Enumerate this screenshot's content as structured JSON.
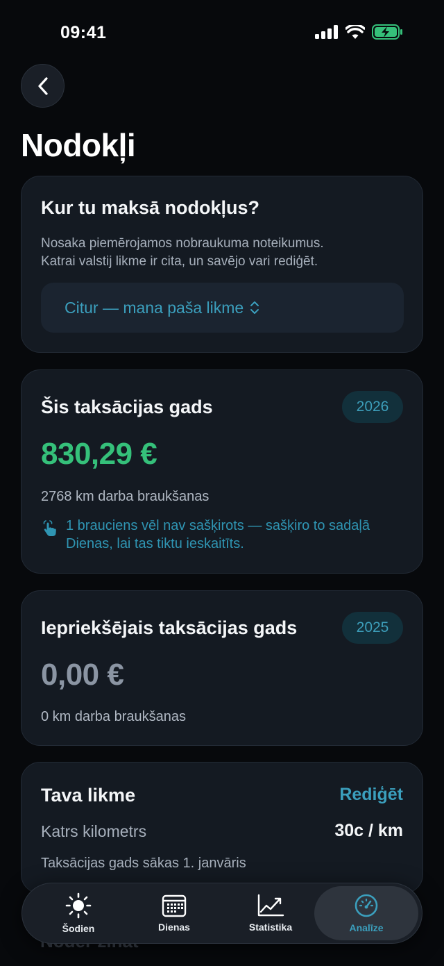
{
  "status_bar": {
    "time": "09:41"
  },
  "page": {
    "title": "Nodokļi"
  },
  "location_card": {
    "title": "Kur tu maksā nodokļus?",
    "description_lines": [
      "Nosaka piemērojamos nobraukuma noteikumus.",
      "Katrai valstij likme ir cita, un savējo vari rediģēt."
    ],
    "selected_option": "Citur — mana paša likme"
  },
  "current_year_card": {
    "title": "Šis taksācijas gads",
    "year": "2026",
    "amount": "830,29 €",
    "km_text": "2768 km darba braukšanas",
    "notice_lines": [
      "1 brauciens vēl nav sašķirots — sašķiro to sadaļā",
      "Dienas, lai tas tiktu ieskaitīts."
    ]
  },
  "previous_year_card": {
    "title": "Iepriekšējais taksācijas gads",
    "year": "2025",
    "amount": "0,00 €",
    "km_text": "0 km darba braukšanas"
  },
  "rate_card": {
    "title": "Tava likme",
    "edit_label": "Rediģēt",
    "rate_label": "Katrs kilometrs",
    "rate_value": "30c / km",
    "note": "Taksācijas gads sākas 1. janvāris"
  },
  "peek_section_title": "Noder zināt",
  "tab_bar": {
    "tabs": [
      {
        "label": "Šodien",
        "icon": "sun-icon"
      },
      {
        "label": "Dienas",
        "icon": "calendar-icon"
      },
      {
        "label": "Statistika",
        "icon": "chart-icon"
      },
      {
        "label": "Analīze",
        "icon": "gauge-icon"
      }
    ],
    "active_tab": "Analīze"
  },
  "colors": {
    "accent": "#3b9fbd",
    "positive": "#35c07a",
    "card": "#141a22",
    "background": "#07090c"
  }
}
